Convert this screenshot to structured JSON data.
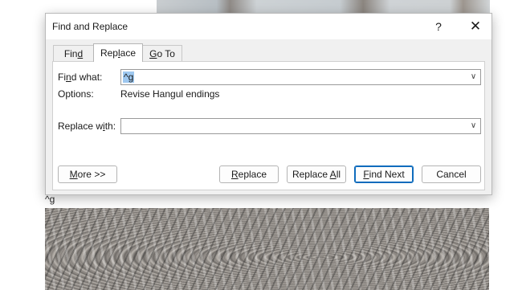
{
  "document": {
    "text_below_dialog": "^g"
  },
  "dialog": {
    "title": "Find and Replace",
    "help_label": "?",
    "close_label": "✕",
    "tabs": [
      {
        "pre": "Fin",
        "key": "d",
        "post": ""
      },
      {
        "pre": "Rep",
        "key": "l",
        "post": "ace"
      },
      {
        "pre": "",
        "key": "G",
        "post": "o To"
      }
    ],
    "active_tab": "Replace",
    "find": {
      "pre": "Fi",
      "key": "n",
      "post": "d what:",
      "value": "^g"
    },
    "options": {
      "label": "Options:",
      "value": "Revise Hangul endings"
    },
    "replace": {
      "pre": "Replace w",
      "key": "i",
      "post": "th:",
      "value": ""
    },
    "dropdown_glyph": "∨",
    "buttons": {
      "more": {
        "pre": "",
        "key": "M",
        "post": "ore >>"
      },
      "replace": {
        "pre": "",
        "key": "R",
        "post": "eplace"
      },
      "replace_all": {
        "pre": "Replace ",
        "key": "A",
        "post": "ll"
      },
      "find_next": {
        "pre": "",
        "key": "F",
        "post": "ind Next"
      },
      "cancel": {
        "label": "Cancel"
      }
    }
  }
}
